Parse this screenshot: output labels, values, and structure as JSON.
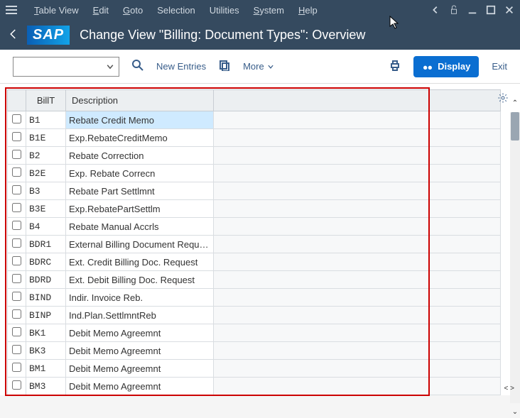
{
  "menu": {
    "table_view": "Table View",
    "edit": "Edit",
    "goto": "Goto",
    "selection": "Selection",
    "utilities": "Utilities",
    "system": "System",
    "help": "Help"
  },
  "title": "Change View \"Billing: Document Types\": Overview",
  "toolbar": {
    "new_entries": "New Entries",
    "more": "More",
    "display": "Display",
    "exit": "Exit"
  },
  "table": {
    "headers": {
      "billt": "BillT",
      "description": "Description"
    },
    "rows": [
      {
        "billt": "B1",
        "desc": "Rebate Credit Memo",
        "selected": true
      },
      {
        "billt": "B1E",
        "desc": "Exp.RebateCreditMemo"
      },
      {
        "billt": "B2",
        "desc": "Rebate Correction"
      },
      {
        "billt": "B2E",
        "desc": "Exp. Rebate Correcn"
      },
      {
        "billt": "B3",
        "desc": "Rebate Part Settlmnt"
      },
      {
        "billt": "B3E",
        "desc": "Exp.RebatePartSettlm"
      },
      {
        "billt": "B4",
        "desc": "Rebate Manual Accrls"
      },
      {
        "billt": "BDR1",
        "desc": "External Billing Document Requ…"
      },
      {
        "billt": "BDRC",
        "desc": "Ext. Credit Billing Doc. Request"
      },
      {
        "billt": "BDRD",
        "desc": "Ext. Debit Billing Doc. Request"
      },
      {
        "billt": "BIND",
        "desc": "Indir. Invoice Reb."
      },
      {
        "billt": "BINP",
        "desc": "Ind.Plan.SettlmntReb"
      },
      {
        "billt": "BK1",
        "desc": "Debit Memo Agreemnt"
      },
      {
        "billt": "BK3",
        "desc": "Debit Memo Agreemnt"
      },
      {
        "billt": "BM1",
        "desc": "Debit Memo Agreemnt"
      },
      {
        "billt": "BM3",
        "desc": "Debit Memo Agreemnt"
      }
    ]
  }
}
